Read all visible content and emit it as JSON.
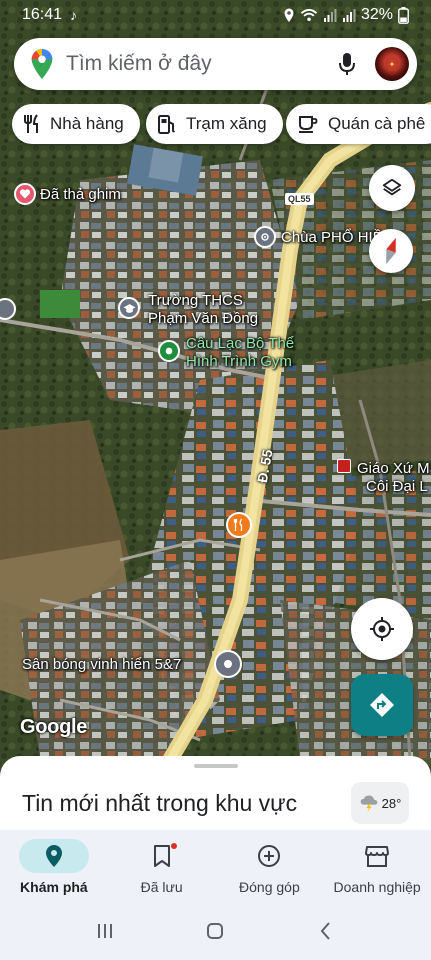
{
  "status_bar": {
    "time": "16:41",
    "battery": "32%"
  },
  "search": {
    "placeholder": "Tìm kiếm ở đây"
  },
  "chips": [
    {
      "label": "Nhà hàng",
      "icon": "restaurant-icon"
    },
    {
      "label": "Trạm xăng",
      "icon": "gas-station-icon"
    },
    {
      "label": "Quán cà phê",
      "icon": "coffee-icon"
    }
  ],
  "map": {
    "labels": {
      "pinned": "Đã thả ghim",
      "route_shield": "QL55",
      "pagoda": "Chùa PHỔ HIỀN",
      "school_line1": "Trường THCS",
      "school_line2": "Phạm Văn Đồng",
      "gym_line1": "Câu Lạc Bộ Thể",
      "gym_line2": "Hình Trình Gym",
      "road": "Đ. 55",
      "parish_line1": "Giáo Xứ M",
      "parish_line2": "Côi Đại L",
      "stadium": "Sân bóng vinh hiển 5&7",
      "logo": "Google"
    }
  },
  "sheet": {
    "title": "Tin mới nhất trong khu vực",
    "weather": "28°"
  },
  "nav": [
    {
      "label": "Khám phá",
      "icon": "explore-pin-icon",
      "active": true
    },
    {
      "label": "Đã lưu",
      "icon": "bookmark-icon",
      "active": false
    },
    {
      "label": "Đóng góp",
      "icon": "add-circle-icon",
      "active": false
    },
    {
      "label": "Doanh nghiệp",
      "icon": "storefront-icon",
      "active": false
    }
  ],
  "colors": {
    "accent": "#0f7f86",
    "active_pill": "#c8e9ee",
    "road": "#d9c27a"
  }
}
